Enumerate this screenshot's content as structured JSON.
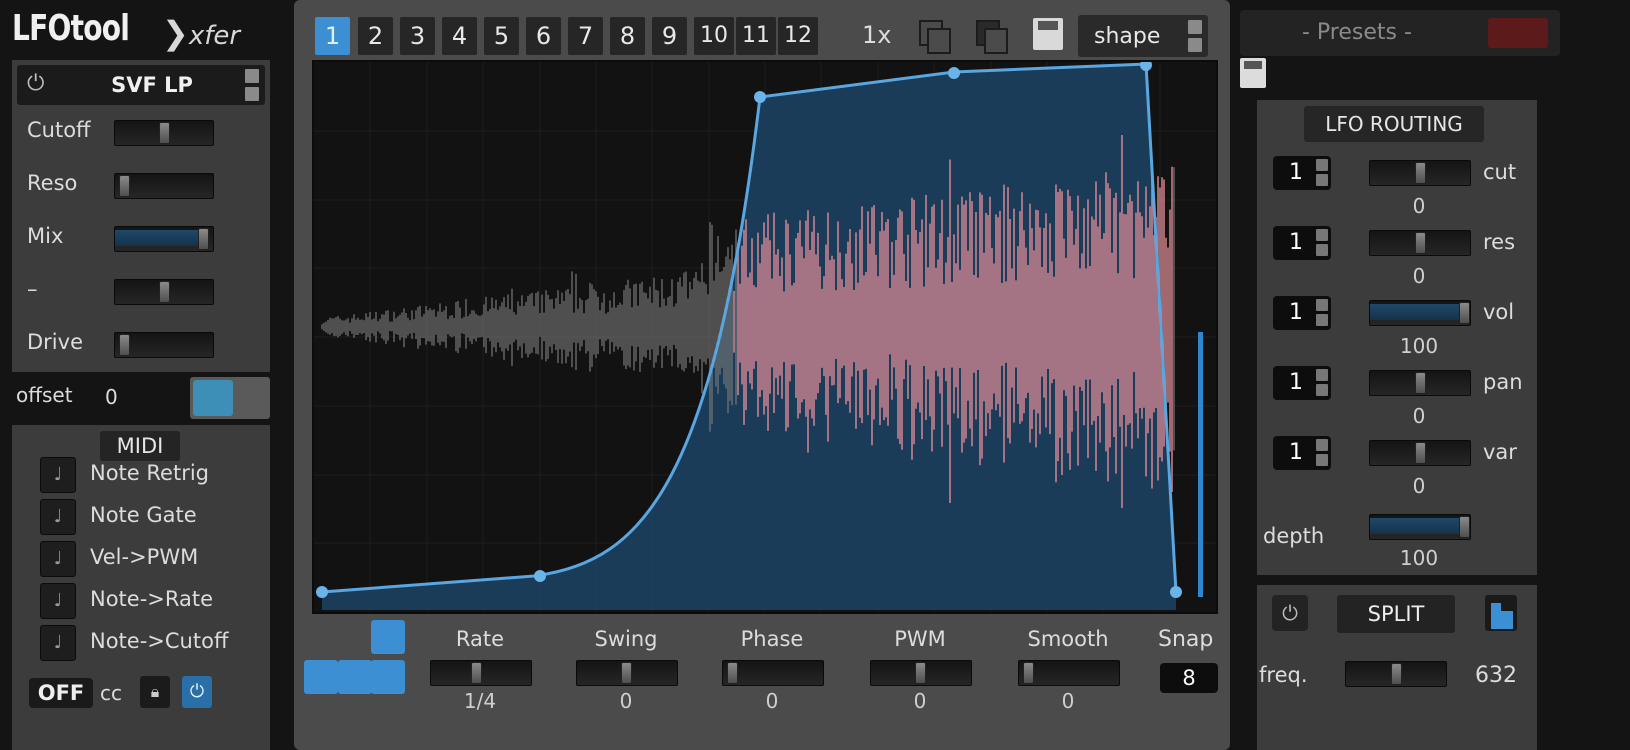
{
  "brand": {
    "name": "LFOtool",
    "maker": "xfer"
  },
  "filter": {
    "type": "SVF LP",
    "params": [
      {
        "label": "Cutoff",
        "value": 0.5
      },
      {
        "label": "Reso",
        "value": 0.05
      },
      {
        "label": "Mix",
        "value": 0.95
      },
      {
        "label": "–",
        "value": 0.5
      },
      {
        "label": "Drive",
        "value": 0.05
      }
    ],
    "offset_label": "offset",
    "offset_value": "0"
  },
  "midi": {
    "title": "MIDI",
    "options": [
      "Note Retrig",
      "Note Gate",
      "Vel->PWM",
      "Note->Rate",
      "Note->Cutoff"
    ],
    "cc_state": "OFF",
    "cc_label": "cc"
  },
  "top": {
    "tabs": [
      "1",
      "2",
      "3",
      "4",
      "5",
      "6",
      "7",
      "8",
      "9",
      "10",
      "11",
      "12"
    ],
    "active_tab": 0,
    "multiplier": "1x",
    "shape_label": "shape"
  },
  "controls": [
    {
      "label": "Rate",
      "value_text": "1/4",
      "value": 0.45
    },
    {
      "label": "Swing",
      "value_text": "0",
      "value": 0.5
    },
    {
      "label": "Phase",
      "value_text": "0",
      "value": 0.05
    },
    {
      "label": "PWM",
      "value_text": "0",
      "value": 0.5
    },
    {
      "label": "Smooth",
      "value_text": "0",
      "value": 0.05
    }
  ],
  "snap": {
    "label": "Snap",
    "value": "8"
  },
  "presets": {
    "label": "- Presets -"
  },
  "routing": {
    "title": "LFO ROUTING",
    "rows": [
      {
        "num": "1",
        "label": "cut",
        "value": "0",
        "pos": 0.5
      },
      {
        "num": "1",
        "label": "res",
        "value": "0",
        "pos": 0.5
      },
      {
        "num": "1",
        "label": "vol",
        "value": "100",
        "pos": 1.0
      },
      {
        "num": "1",
        "label": "pan",
        "value": "0",
        "pos": 0.5
      },
      {
        "num": "1",
        "label": "var",
        "value": "0",
        "pos": 0.5
      }
    ],
    "depth_label": "depth",
    "depth_value": "100"
  },
  "split": {
    "label": "SPLIT",
    "freq_label": "freq.",
    "freq_value": "632",
    "freq_pos": 0.5
  },
  "colors": {
    "accent": "#3d8fd4",
    "envelope_fill": "#1c4466",
    "audio": "#d98a96",
    "audio_dim": "#8a8a8a"
  }
}
